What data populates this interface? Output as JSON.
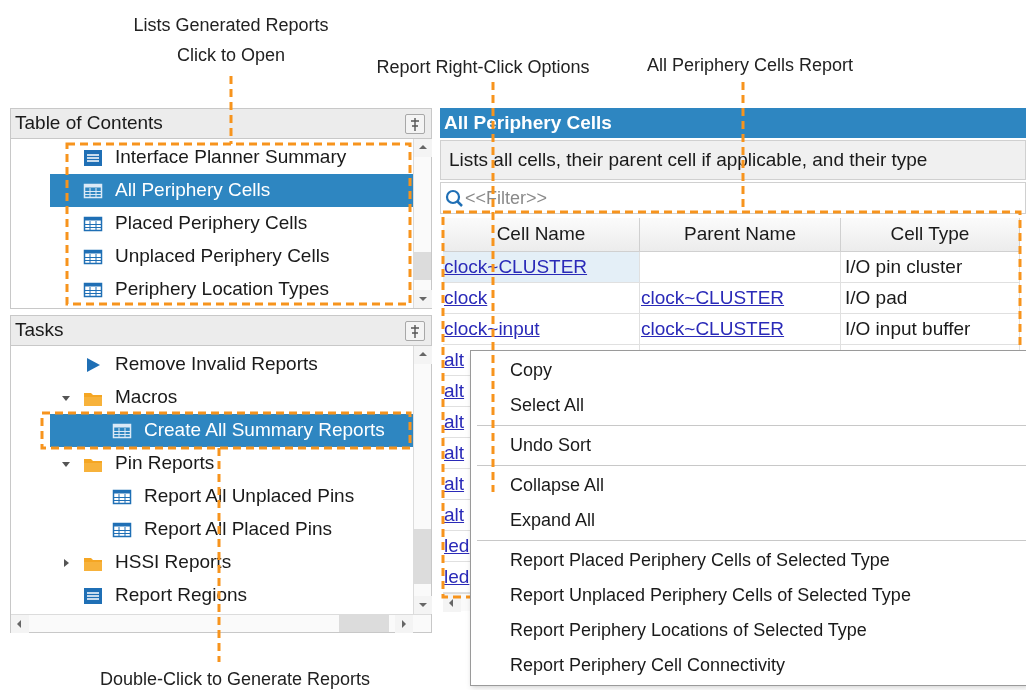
{
  "annotations": [
    {
      "lines": [
        "Lists Generated Reports",
        "Click to Open"
      ]
    },
    {
      "lines": [
        "Report Right-Click Options"
      ]
    },
    {
      "lines": [
        "All Periphery Cells Report"
      ]
    },
    {
      "lines": [
        "Double-Click to Generate Reports"
      ]
    }
  ],
  "table_of_contents": {
    "title": "Table of Contents",
    "items": [
      {
        "label": "Interface Planner Summary",
        "kind": "summary",
        "selected": false
      },
      {
        "label": "All Periphery Cells",
        "kind": "table",
        "selected": true
      },
      {
        "label": "Placed Periphery Cells",
        "kind": "table",
        "selected": false
      },
      {
        "label": "Unplaced Periphery Cells",
        "kind": "table",
        "selected": false
      },
      {
        "label": "Periphery Location Types",
        "kind": "table",
        "selected": false
      }
    ]
  },
  "tasks": {
    "title": "Tasks",
    "items": [
      {
        "label": "Remove Invalid Reports",
        "kind": "run",
        "selected": false
      },
      {
        "label": "Macros",
        "kind": "folder",
        "expanded": true,
        "selected": false,
        "children": [
          {
            "label": "Create All Summary Reports",
            "kind": "table",
            "selected": true
          }
        ]
      },
      {
        "label": "Pin Reports",
        "kind": "folder",
        "expanded": true,
        "selected": false,
        "children": [
          {
            "label": "Report All Unplaced Pins",
            "kind": "table",
            "selected": false
          },
          {
            "label": "Report All Placed Pins",
            "kind": "table",
            "selected": false
          }
        ]
      },
      {
        "label": "HSSI Reports",
        "kind": "folder",
        "expanded": false,
        "selected": false
      },
      {
        "label": "Report Regions",
        "kind": "summary",
        "selected": false
      }
    ]
  },
  "report": {
    "title": "All Periphery Cells",
    "description": "Lists all cells, their parent cell if applicable, and their type",
    "filter": {
      "placeholder": "<<Filter>>"
    },
    "columns": [
      "Cell Name",
      "Parent Name",
      "Cell Type"
    ],
    "rows": [
      {
        "cell_name": "clock~CLUSTER",
        "cell_type": "I/O pin cluster",
        "selected": true
      },
      {
        "cell_name": "clock",
        "parent_name": "clock~CLUSTER",
        "cell_type": "I/O pad",
        "selected": false
      },
      {
        "cell_name": "clock~input",
        "parent_name": "clock~CLUSTER",
        "cell_type": "I/O input buffer",
        "selected": false
      },
      {
        "cell_name": "alt",
        "selected": false
      },
      {
        "cell_name": "alt",
        "selected": false
      },
      {
        "cell_name": "alt",
        "selected": false
      },
      {
        "cell_name": "alt",
        "selected": false
      },
      {
        "cell_name": "alt",
        "selected": false
      },
      {
        "cell_name": "alt",
        "selected": false
      },
      {
        "cell_name": "led",
        "selected": false
      },
      {
        "cell_name": "led",
        "selected": false
      }
    ]
  },
  "context_menu": {
    "groups": [
      [
        {
          "label": "Copy"
        },
        {
          "label": "Select All"
        }
      ],
      [
        {
          "label": "Undo Sort"
        }
      ],
      [
        {
          "label": "Collapse All"
        },
        {
          "label": "Expand All"
        }
      ],
      [
        {
          "label": "Report Placed Periphery Cells of Selected Type"
        },
        {
          "label": "Report Unplaced Periphery Cells of Selected Type"
        },
        {
          "label": "Report Periphery Locations of Selected Type"
        },
        {
          "label": "Report Periphery Cell Connectivity"
        }
      ]
    ]
  }
}
